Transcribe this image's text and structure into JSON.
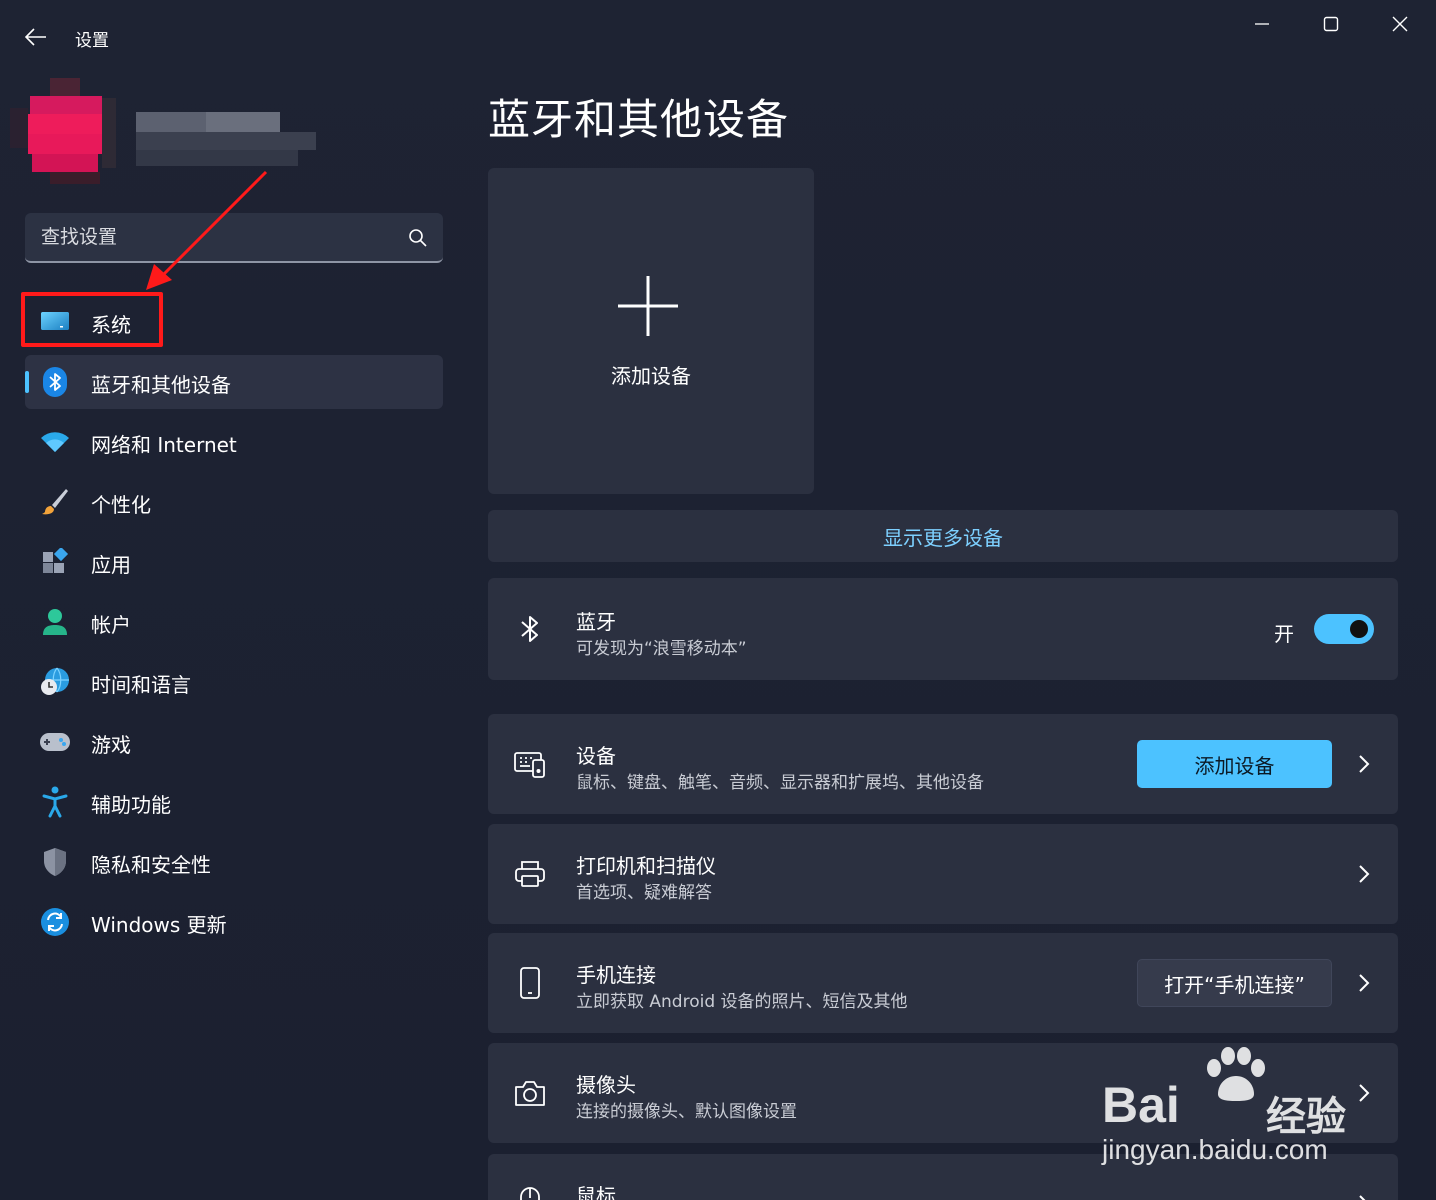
{
  "window": {
    "title": "设置"
  },
  "search": {
    "placeholder": "查找设置"
  },
  "nav": {
    "items": [
      {
        "label": "系统",
        "icon": "monitor-icon"
      },
      {
        "label": "蓝牙和其他设备",
        "icon": "bluetooth-icon",
        "active": true
      },
      {
        "label": "网络和 Internet",
        "icon": "wifi-icon"
      },
      {
        "label": "个性化",
        "icon": "brush-icon"
      },
      {
        "label": "应用",
        "icon": "apps-icon"
      },
      {
        "label": "帐户",
        "icon": "person-icon"
      },
      {
        "label": "时间和语言",
        "icon": "globe-clock-icon"
      },
      {
        "label": "游戏",
        "icon": "gamepad-icon"
      },
      {
        "label": "辅助功能",
        "icon": "accessibility-icon"
      },
      {
        "label": "隐私和安全性",
        "icon": "shield-icon"
      },
      {
        "label": "Windows 更新",
        "icon": "update-icon"
      }
    ]
  },
  "main": {
    "title": "蓝牙和其他设备",
    "add_tile_label": "添加设备",
    "more_devices": "显示更多设备",
    "bluetooth": {
      "title": "蓝牙",
      "subtitle": "可发现为“浪雪移动本”",
      "toggle_label": "开",
      "on": true
    },
    "cards": [
      {
        "title": "设备",
        "subtitle": "鼠标、键盘、触笔、音频、显示器和扩展坞、其他设备",
        "button": "添加设备",
        "icon": "devices-icon"
      },
      {
        "title": "打印机和扫描仪",
        "subtitle": "首选项、疑难解答",
        "icon": "printer-icon"
      },
      {
        "title": "手机连接",
        "subtitle": "立即获取 Android 设备的照片、短信及其他",
        "button": "打开“手机连接”",
        "icon": "phone-icon"
      },
      {
        "title": "摄像头",
        "subtitle": "连接的摄像头、默认图像设置",
        "icon": "camera-icon"
      },
      {
        "title": "鼠标",
        "icon": "mouse-icon"
      }
    ]
  },
  "watermark": {
    "brand": "Bai",
    "brand2": "经验",
    "url": "jingyan.baidu.com"
  },
  "colors": {
    "accent": "#4cc2ff",
    "annotation": "#ff1a1a",
    "background": "#1d2232",
    "card": "#2b3040"
  }
}
